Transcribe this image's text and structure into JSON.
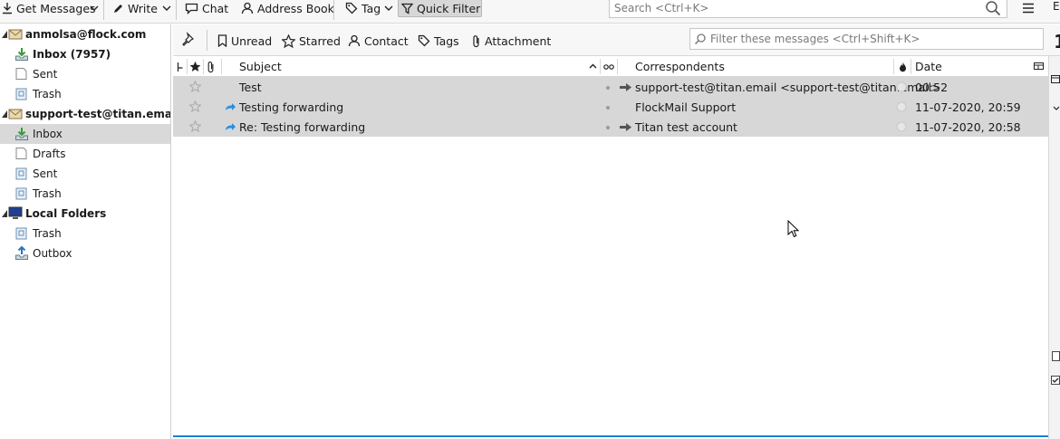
{
  "toolbar": {
    "get_messages": "Get Messages",
    "write": "Write",
    "chat": "Chat",
    "address_book": "Address Book",
    "tag": "Tag",
    "quick_filter": "Quick Filter",
    "search_placeholder": "Search <Ctrl+K>",
    "right_edge_label": "E"
  },
  "folders": {
    "account1": {
      "name": "anmolsa@flock.com",
      "inbox": "Inbox (7957)",
      "sent": "Sent",
      "trash": "Trash"
    },
    "account2": {
      "name": "support-test@titan.email",
      "inbox": "Inbox",
      "drafts": "Drafts",
      "sent": "Sent",
      "trash": "Trash"
    },
    "local": {
      "name": "Local Folders",
      "trash": "Trash",
      "outbox": "Outbox"
    }
  },
  "quick_filter_bar": {
    "unread": "Unread",
    "starred": "Starred",
    "contact": "Contact",
    "tags": "Tags",
    "attachment": "Attachment",
    "filter_placeholder": "Filter these messages <Ctrl+Shift+K>",
    "right_edge_glyph": "1"
  },
  "columns": {
    "subject": "Subject",
    "correspondents": "Correspondents",
    "date": "Date"
  },
  "messages": [
    {
      "subject": "Test",
      "correspondent": "support-test@titan.email <support-test@titan.email>",
      "date": "00:52",
      "forwarded": false,
      "outgoing": true
    },
    {
      "subject": "Testing forwarding",
      "correspondent": "FlockMail Support",
      "date": "11-07-2020, 20:59",
      "forwarded": true,
      "outgoing": false
    },
    {
      "subject": "Re: Testing forwarding",
      "correspondent": "Titan test account",
      "date": "11-07-2020, 20:58",
      "forwarded": true,
      "outgoing": true
    }
  ],
  "colors": {
    "selection_bg": "#d9d9d9",
    "row_bg": "#d7d7d7",
    "accent_blue": "#0a84d6",
    "inbox_green": "#3c9a35"
  }
}
